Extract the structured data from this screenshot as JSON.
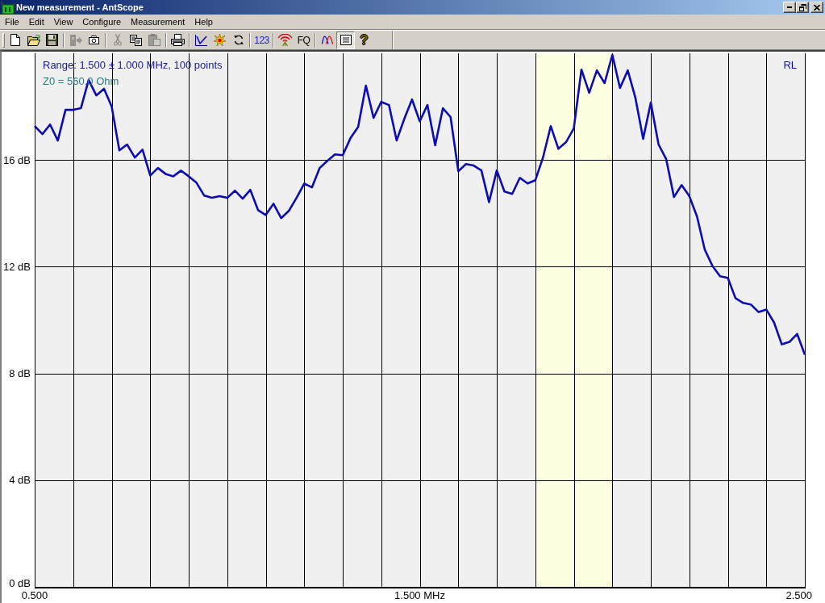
{
  "window": {
    "title": "New measurement - AntScope"
  },
  "menu": [
    "File",
    "Edit",
    "View",
    "Configure",
    "Measurement",
    "Help"
  ],
  "toolbar": [
    {
      "buttons": [
        {
          "kind": "new",
          "disabled": false,
          "on": false
        },
        {
          "kind": "open",
          "disabled": false,
          "on": false
        },
        {
          "kind": "save",
          "disabled": false,
          "on": false
        }
      ]
    },
    {
      "buttons": [
        {
          "kind": "export",
          "disabled": true,
          "on": false
        },
        {
          "kind": "camera",
          "disabled": false,
          "on": false
        }
      ]
    },
    {
      "buttons": [
        {
          "kind": "cut",
          "disabled": true,
          "on": false
        },
        {
          "kind": "copy",
          "disabled": false,
          "on": false
        },
        {
          "kind": "paste",
          "disabled": true,
          "on": false
        }
      ]
    },
    {
      "buttons": [
        {
          "kind": "print",
          "disabled": false,
          "on": false
        }
      ]
    },
    {
      "buttons": [
        {
          "kind": "graph",
          "disabled": false,
          "on": false
        },
        {
          "kind": "burst",
          "disabled": false,
          "on": false
        },
        {
          "kind": "refresh",
          "disabled": false,
          "on": false
        }
      ]
    },
    {
      "buttons": [
        {
          "kind": "text",
          "label": "123",
          "color": "#2020d0",
          "disabled": false,
          "on": false
        }
      ]
    },
    {
      "buttons": [
        {
          "kind": "antenna",
          "disabled": false,
          "on": false
        },
        {
          "kind": "text",
          "label": "FQ",
          "color": "#000000",
          "disabled": false,
          "on": false
        }
      ]
    },
    {
      "buttons": [
        {
          "kind": "curves",
          "disabled": false,
          "on": false
        },
        {
          "kind": "list",
          "disabled": false,
          "on": true
        },
        {
          "kind": "help",
          "label": "?",
          "disabled": false,
          "on": false
        }
      ]
    }
  ],
  "plot": {
    "info": [
      {
        "text": "Range: 1.500 ± 1.000 MHz, 100 points",
        "color": "#1c1c8c"
      },
      {
        "text": "Z0 = 560.0 Ohm",
        "color": "#2e7c7c"
      }
    ],
    "chart_data": {
      "type": "line",
      "x": [
        0.5,
        0.52,
        0.54,
        0.56,
        0.58,
        0.6,
        0.62,
        0.64,
        0.66,
        0.68,
        0.7,
        0.72,
        0.74,
        0.76,
        0.78,
        0.8,
        0.82,
        0.84,
        0.86,
        0.88,
        0.9,
        0.92,
        0.94,
        0.96,
        0.98,
        1.0,
        1.02,
        1.04,
        1.06,
        1.08,
        1.1,
        1.12,
        1.14,
        1.16,
        1.18,
        1.2,
        1.22,
        1.24,
        1.26,
        1.28,
        1.3,
        1.32,
        1.34,
        1.36,
        1.38,
        1.4,
        1.42,
        1.44,
        1.46,
        1.48,
        1.5,
        1.52,
        1.54,
        1.56,
        1.58,
        1.6,
        1.62,
        1.64,
        1.66,
        1.68,
        1.7,
        1.72,
        1.74,
        1.76,
        1.78,
        1.8,
        1.82,
        1.84,
        1.86,
        1.88,
        1.9,
        1.92,
        1.94,
        1.96,
        1.98,
        2.0,
        2.02,
        2.04,
        2.06,
        2.08,
        2.1,
        2.12,
        2.14,
        2.16,
        2.18,
        2.2,
        2.22,
        2.24,
        2.26,
        2.28,
        2.3,
        2.32,
        2.34,
        2.36,
        2.38,
        2.4,
        2.42,
        2.44,
        2.46,
        2.48,
        2.5
      ],
      "series": [
        {
          "name": "RL",
          "color": "#0c0cb4",
          "values": [
            17.27,
            16.97,
            17.33,
            16.73,
            17.88,
            17.88,
            17.94,
            19.0,
            18.42,
            18.67,
            18.0,
            16.36,
            16.58,
            16.09,
            16.39,
            15.42,
            15.7,
            15.48,
            15.39,
            15.6,
            15.39,
            15.15,
            14.67,
            14.58,
            14.64,
            14.58,
            14.85,
            14.55,
            14.88,
            14.12,
            13.94,
            14.36,
            13.82,
            14.09,
            14.58,
            15.12,
            14.97,
            15.7,
            15.97,
            16.21,
            16.18,
            16.82,
            17.24,
            18.79,
            17.58,
            18.18,
            18.06,
            16.73,
            17.55,
            18.27,
            17.45,
            18.06,
            16.55,
            17.94,
            17.61,
            15.58,
            15.85,
            15.79,
            15.61,
            14.42,
            15.61,
            14.82,
            14.73,
            15.33,
            15.12,
            15.24,
            16.09,
            17.27,
            16.42,
            16.67,
            17.18,
            19.39,
            18.52,
            19.36,
            18.88,
            19.94,
            18.7,
            19.36,
            18.33,
            16.79,
            18.15,
            16.58,
            16.03,
            14.61,
            15.06,
            14.64,
            13.88,
            12.64,
            12.03,
            11.64,
            11.58,
            10.82,
            10.64,
            10.58,
            10.3,
            10.39,
            9.91,
            9.09,
            9.18,
            9.48,
            8.7
          ]
        }
      ],
      "xlim": [
        0.5,
        2.5
      ],
      "ylim": [
        0,
        20
      ],
      "xticks": [
        {
          "value": 0.5,
          "label": "0.500"
        },
        {
          "value": 1.5,
          "label": "1.500 MHz"
        },
        {
          "value": 2.5,
          "label": "2.500"
        }
      ],
      "yticks": [
        {
          "value": 0,
          "label": "0 dB"
        },
        {
          "value": 4,
          "label": "4 dB"
        },
        {
          "value": 8,
          "label": "8 dB"
        },
        {
          "value": 12,
          "label": "12 dB"
        },
        {
          "value": 16,
          "label": "16 dB"
        }
      ],
      "grid": true,
      "bands": [
        {
          "axis": "x",
          "from": 1.8,
          "to": 2.0,
          "color": "#fefee0"
        }
      ]
    }
  }
}
